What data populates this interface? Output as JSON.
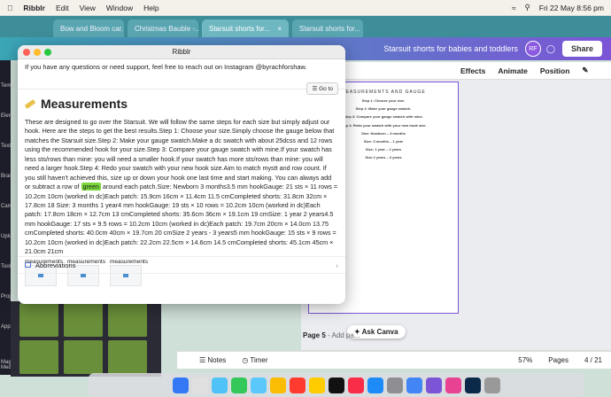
{
  "menubar": {
    "app": "Ribblr",
    "items": [
      "Edit",
      "View",
      "Window",
      "Help"
    ],
    "datetime": "Fri 22 May 8:56 pm"
  },
  "browser": {
    "tabs": [
      {
        "label": "Bow and Bloom car..."
      },
      {
        "label": "Christmas Bauble -..."
      },
      {
        "label": "Starsuit shorts for..."
      },
      {
        "label": "Starsuit shorts for..."
      }
    ]
  },
  "canva": {
    "doc_title": "Starsuit shorts for babies and toddlers",
    "avatar": "RF",
    "share": "Share",
    "toolbar": [
      "Effects",
      "Animate",
      "Position"
    ],
    "page5_label": "Page 5",
    "page5_add": "- Add pa...",
    "ask_canva": "Ask Canva",
    "notes": "Notes",
    "timer": "Timer",
    "zoom": "57%",
    "pages": "Pages",
    "page_count": "4 / 21",
    "rail_labels": [
      "Temp",
      "Elem",
      "Text",
      "Bran",
      "Cam",
      "Uplo",
      "Tools",
      "Proj",
      "Apps",
      "Magic Media"
    ],
    "doc_preview": {
      "header": "MEASUREMENTS AND GAUGE",
      "lines": [
        "Step 1: Choose your size.",
        "Step 2: Make your gauge swatch.",
        "Step 3: Compare your gauge swatch with mine.",
        "Step 4: Redo your swatch with your new hook size.",
        "Size: Newborn – 3 months",
        "Size: 3 months – 1 year",
        "Size: 1 year – 2 years",
        "Size 2 years – 3 years"
      ]
    }
  },
  "ribblr": {
    "window_title": "Ribblr",
    "contact": "If you have any questions or need support, feel free to reach out on Instagram @byrachforshaw.",
    "goto": "Go to",
    "heading": "Measurements",
    "body_before": "These are designed to go over the Starsuit. We will follow the same steps for each size but simply adjust our hook. Here are the steps to get the best results.Step 1: Choose your size.Simply choose the gauge below that matches the Starsuit size.Step 2: Make your gauge swatch.Make a dc swatch with about 25dcss and 12 rows using the recommended hook for your size.Step 3: Compare your gauge swatch with mine.If your swatch has less sts/rows than mine: you will need a smaller hook.If your swatch has more sts/rows than mine: you will need a larger hook.Step 4: Redo your swatch with your new hook size.Aim to match mystt and row count. If you still haven't achieved this, size up or down your hook one last time and start making. You can always add or subtract a row of",
    "highlight": "green",
    "body_after": "around each patch.Size: Newborn 3 months3.5 mm hookGauge: 21 sts × 11 rows = 10.2cm 10cm (worked in dc)Each patch: 15.9cm 16cm × 11.4cm 11.5 cmCompleted shorts: 31.8cm 32cm × 17.8cm 18 Size: 3 months 1 year4 mm hookGauge: 19 sts × 10 rows = 10.2cm 10cm (worked in dc)Each patch: 17.8cm 18cm × 12.7cm 13 cmCompleted shorts: 35.6cm 36cm × 19.1cm 19 cmSize: 1 year 2 years4.5 mm hookGauge: 17 sts × 9.5 rows = 10.2cm 10cm (worked in dc)Each patch: 19.7cm 20cm × 14.0cm 13.75 cmCompleted shorts: 40.0cm 40cm × 19.7cm 20 cmSize 2 years - 3 years5 mm hookGauge: 15 sts × 9 rows = 10.2cm 10cm (worked in dc)Each patch: 22.2cm 22.5cm × 14.6cm 14.5 cmCompleted shorts: 45.1cm 45cm × 21.0cm 21cm",
    "images": [
      "measurements",
      "measurements",
      "measurements"
    ],
    "abbreviations": "Abbreviations"
  }
}
